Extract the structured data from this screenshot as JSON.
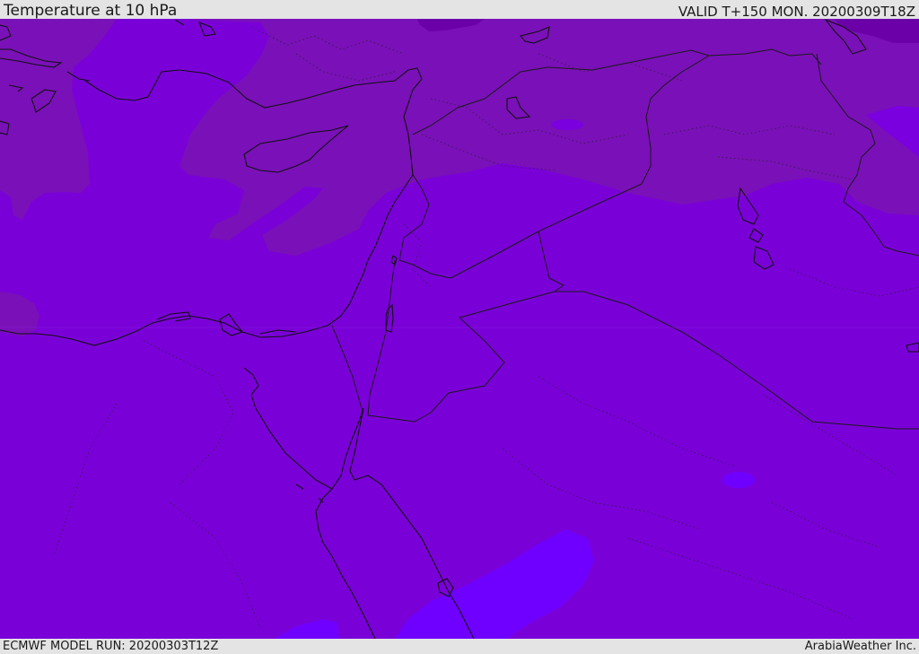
{
  "header": {
    "title": "Temperature at 10 hPa",
    "valid": "VALID T+150 MON. 20200309T18Z"
  },
  "footer": {
    "model_run": "ECMWF MODEL RUN: 20200303T12Z",
    "brand": "ArabiaWeather Inc."
  },
  "map": {
    "colors": {
      "base": "#7a00d8",
      "warm_band": "#7a10b8",
      "darker_band": "#6c00a8",
      "cold_band": "#6f00ff",
      "coast": "#111111",
      "border": "#1a1a1a"
    }
  }
}
